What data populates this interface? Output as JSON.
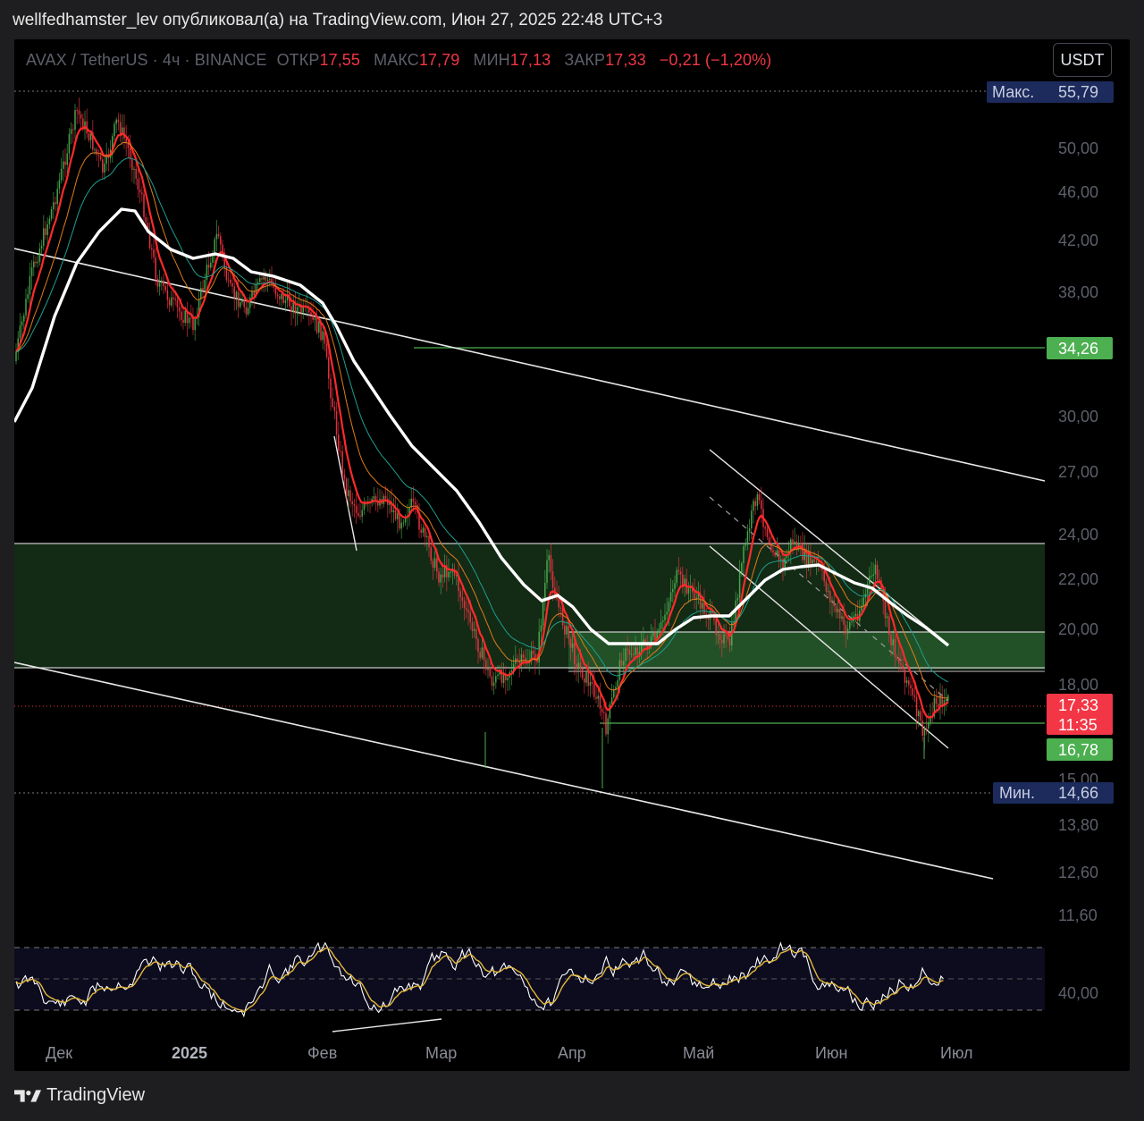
{
  "header": {
    "text": "wellfedhamster_lev опубликовал(а) на TradingView.com, Июн 27, 2025 22:48 UTC+3"
  },
  "legend": {
    "symbol": "AVAX / TetherUS · 4ч · BINANCE",
    "open_label": "ОТКР",
    "open": "17,55",
    "high_label": "МАКС",
    "high": "17,79",
    "low_label": "МИН",
    "low": "17,13",
    "close_label": "ЗАКР",
    "close": "17,33",
    "change": "−0,21 (−1,20%)"
  },
  "currency_button": "USDT",
  "brand": "TradingView",
  "colors": {
    "up": "#4caf50",
    "down": "#f23645",
    "accent_green": "#4caf50",
    "label_blue": "#1c2b5c",
    "zone_green": "#1b4a22"
  },
  "chart_data": {
    "type": "candlestick",
    "y_ticks": [
      "50,00",
      "46,00",
      "42,00",
      "38,00",
      "30,00",
      "27,00",
      "24,00",
      "22,00",
      "20,00",
      "18,00",
      "15,00",
      "13,80",
      "12,60",
      "11,60"
    ],
    "x_ticks": [
      {
        "label": "Дек",
        "bold": false
      },
      {
        "label": "2025",
        "bold": true
      },
      {
        "label": "Фев",
        "bold": false
      },
      {
        "label": "Мар",
        "bold": false
      },
      {
        "label": "Апр",
        "bold": false
      },
      {
        "label": "Май",
        "bold": false
      },
      {
        "label": "Июн",
        "bold": false
      },
      {
        "label": "Июл",
        "bold": false
      }
    ],
    "max_label": "Макс.",
    "max_value": "55,79",
    "min_label": "Мин.",
    "min_value": "14,66",
    "level_upper": "34,26",
    "last_price": "17,33",
    "countdown": "11:35",
    "level_lower": "16,78",
    "rsi_tick": "40,00",
    "price_path": [
      [
        "Дек",
        "40"
      ],
      [
        "Дек",
        "50"
      ],
      [
        "2025",
        "40"
      ],
      [
        "2025",
        "44"
      ],
      [
        "Фев",
        "38"
      ],
      [
        "Фев",
        "24"
      ],
      [
        "Мар",
        "22"
      ],
      [
        "Мар",
        "18"
      ],
      [
        "Апр",
        "21.5"
      ],
      [
        "Апр",
        "15.5"
      ],
      [
        "Май",
        "22"
      ],
      [
        "Май",
        "26"
      ],
      [
        "Июн",
        "22"
      ],
      [
        "Июн",
        "21"
      ],
      [
        "Июл",
        "16"
      ],
      [
        "Июл",
        "17.33"
      ]
    ]
  }
}
